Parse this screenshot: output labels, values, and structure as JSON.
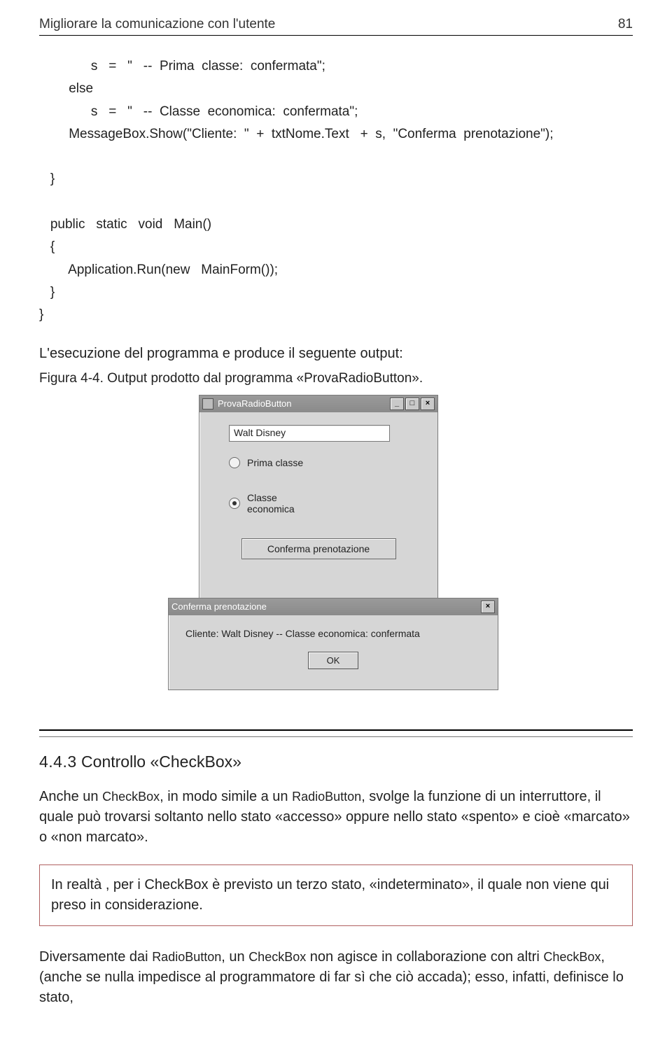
{
  "header": {
    "title": "Migliorare la comunicazione con l'utente",
    "page": "81"
  },
  "code": "              s   =   \"   --  Prima  classe:  confermata\";\n        else\n              s   =   \"   --  Classe  economica:  confermata\";\n        MessageBox.Show(\"Cliente:  \"  +  txtNome.Text   +  s,  \"Conferma  prenotazione\");\n\n   }\n\n   public   static   void   Main()\n   {\n        Application.Run(new   MainForm());\n   }\n}",
  "para_exec": "L'esecuzione del programma e produce il seguente output:",
  "fig_caption": "Figura 4-4.  Output  prodotto  dal  programma «ProvaRadioButton».",
  "win1": {
    "title": "ProvaRadioButton",
    "btn_min": "_",
    "btn_max": "□",
    "btn_close": "×",
    "textbox_value": "Walt Disney",
    "radio1": "Prima classe",
    "radio2_line1": "Classe",
    "radio2_line2": "economica",
    "confirm_btn": "Conferma prenotazione"
  },
  "win2": {
    "title": "Conferma prenotazione",
    "btn_close": "×",
    "message": "Cliente: Walt Disney -- Classe economica: confermata",
    "ok_btn": "OK"
  },
  "section": {
    "num": "4.4.3",
    "title_prefix": "Controllo «",
    "title_key": "CheckBox",
    "title_suffix": "»"
  },
  "para1_a": "Anche un ",
  "para1_b": "CheckBox",
  "para1_c": ", in modo simile a un ",
  "para1_d": "RadioButton",
  "para1_e": ", svolge la funzione di un interruttore, il quale può trovarsi soltanto nello stato «accesso» oppure nello stato «spento» e cioè «marcato» o «non marcato».",
  "note": "In realtà , per i CheckBox è previsto un terzo stato, «indeterminato», il quale non viene qui preso   in considerazione.",
  "para2_a": "Diversamente dai ",
  "para2_b": "RadioButton",
  "para2_c": ", un ",
  "para2_d": "CheckBox",
  "para2_e": " non agisce  in collaborazione con altri ",
  "para2_f": "CheckBox",
  "para2_g": ", (anche se nulla impedisce al programmatore di far sì che ciò accada); esso, infatti, definisce lo stato,"
}
